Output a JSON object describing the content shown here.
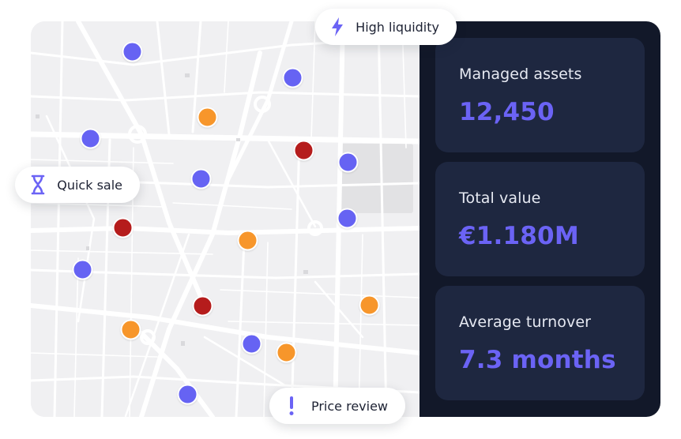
{
  "chips": {
    "high_liquidity": {
      "label": "High liquidity",
      "icon": "lightning-icon"
    },
    "quick_sale": {
      "label": "Quick sale",
      "icon": "hourglass-icon"
    },
    "price_review": {
      "label": "Price review",
      "icon": "exclamation-icon"
    }
  },
  "stats": {
    "managed_assets": {
      "label": "Managed assets",
      "value": "12,450"
    },
    "total_value": {
      "label": "Total value",
      "value": "€1.180M"
    },
    "average_turnover": {
      "label": "Average turnover",
      "value": "7.3 months"
    }
  },
  "colors": {
    "accent": "#6b63f5",
    "pin_purple": "#6663f3",
    "pin_orange": "#f7962b",
    "pin_red": "#b51c1c",
    "panel_dark": "#121829",
    "card_dark": "#1e2740"
  },
  "map": {
    "pin_types": [
      "purple",
      "orange",
      "red"
    ]
  }
}
